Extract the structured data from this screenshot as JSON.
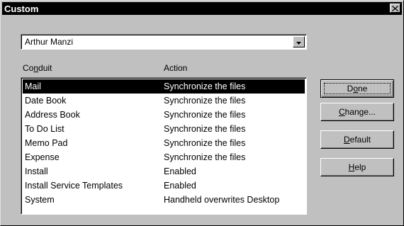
{
  "window": {
    "title": "Custom",
    "close_glyph": "✕"
  },
  "user_select": {
    "value": "Arthur Manzi",
    "arrow_icon": "triangle-down"
  },
  "columns": {
    "conduit": {
      "pre": "Co",
      "mnemonic": "n",
      "post": "duit"
    },
    "action": "Action"
  },
  "conduits": [
    {
      "conduit": "Mail",
      "action": "Synchronize the files",
      "selected": true
    },
    {
      "conduit": "Date Book",
      "action": "Synchronize the files"
    },
    {
      "conduit": "Address Book",
      "action": "Synchronize the files"
    },
    {
      "conduit": "To Do List",
      "action": "Synchronize the files"
    },
    {
      "conduit": "Memo Pad",
      "action": "Synchronize the files"
    },
    {
      "conduit": "Expense",
      "action": "Synchronize the files"
    },
    {
      "conduit": "Install",
      "action": "Enabled"
    },
    {
      "conduit": "Install Service Templates",
      "action": "Enabled"
    },
    {
      "conduit": "System",
      "action": "Handheld overwrites Desktop"
    }
  ],
  "buttons": {
    "done": {
      "pre": "D",
      "mnemonic": "o",
      "post": "ne"
    },
    "change": {
      "pre": "",
      "mnemonic": "C",
      "post": "hange..."
    },
    "default": {
      "pre": "",
      "mnemonic": "D",
      "post": "efault"
    },
    "help": {
      "pre": "",
      "mnemonic": "H",
      "post": "elp"
    }
  }
}
